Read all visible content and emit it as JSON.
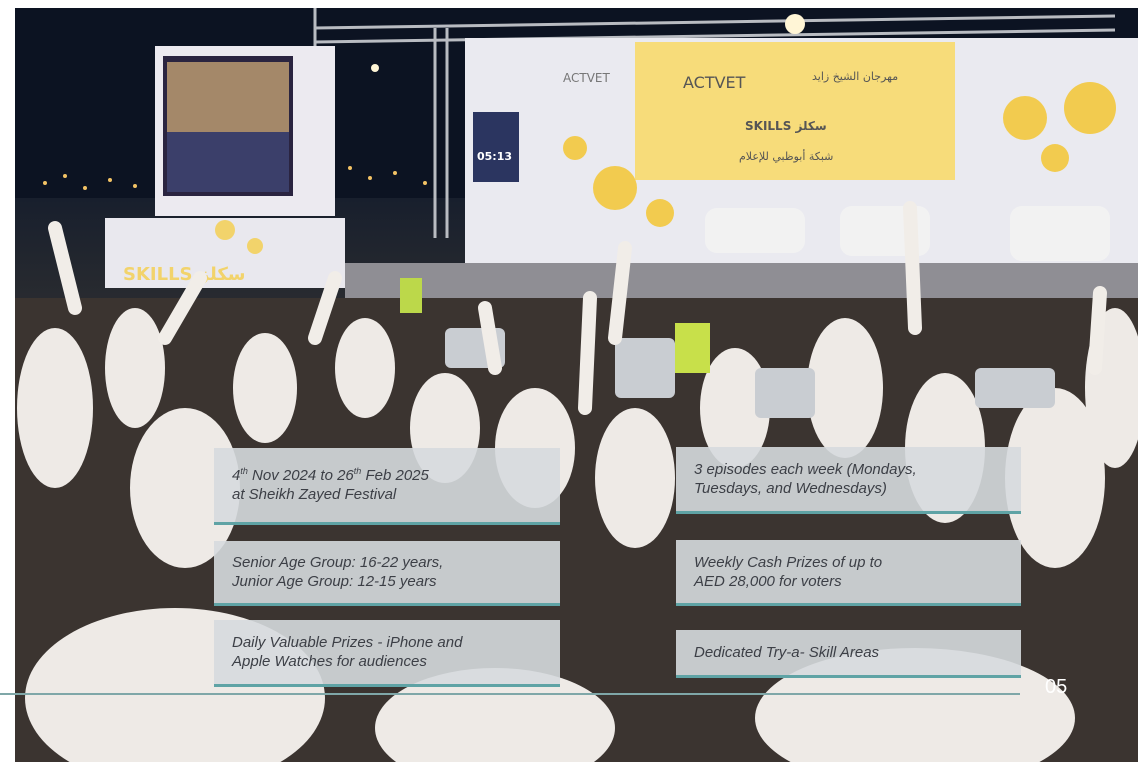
{
  "photo": {
    "screen_logo": "ACTVET",
    "screen_logo_left": "ACTVET",
    "screen_arabic_festival": "مهرجان الشيخ زايد",
    "screen_skills": "SKILLS سكلز",
    "screen_arabic_tagline": "شبكة أبوظبي للإعلام",
    "timer": "05:13",
    "banner_skills": "SKILLS سكلز"
  },
  "cards": {
    "dates": {
      "line1_a": "4",
      "line1_sup_a": "th",
      "line1_b": " Nov 2024 to 26",
      "line1_sup_b": "th",
      "line1_c": " Feb 2025",
      "line2": "at Sheikh Zayed Festival"
    },
    "age": {
      "line1": "Senior Age Group: 16-22 years,",
      "line2": "Junior Age Group: 12-15 years"
    },
    "daily": {
      "line1": "Daily Valuable Prizes - iPhone and",
      "line2": "Apple Watches for audiences"
    },
    "episodes": {
      "line1": "3 episodes each week (Mondays,",
      "line2": "Tuesdays, and Wednesdays)"
    },
    "cash": {
      "line1": "Weekly Cash Prizes of up to",
      "line2": "AED 28,000 for voters"
    },
    "tryskill": {
      "line1": "Dedicated Try-a- Skill Areas"
    }
  },
  "footer": {
    "page_number": "05"
  }
}
